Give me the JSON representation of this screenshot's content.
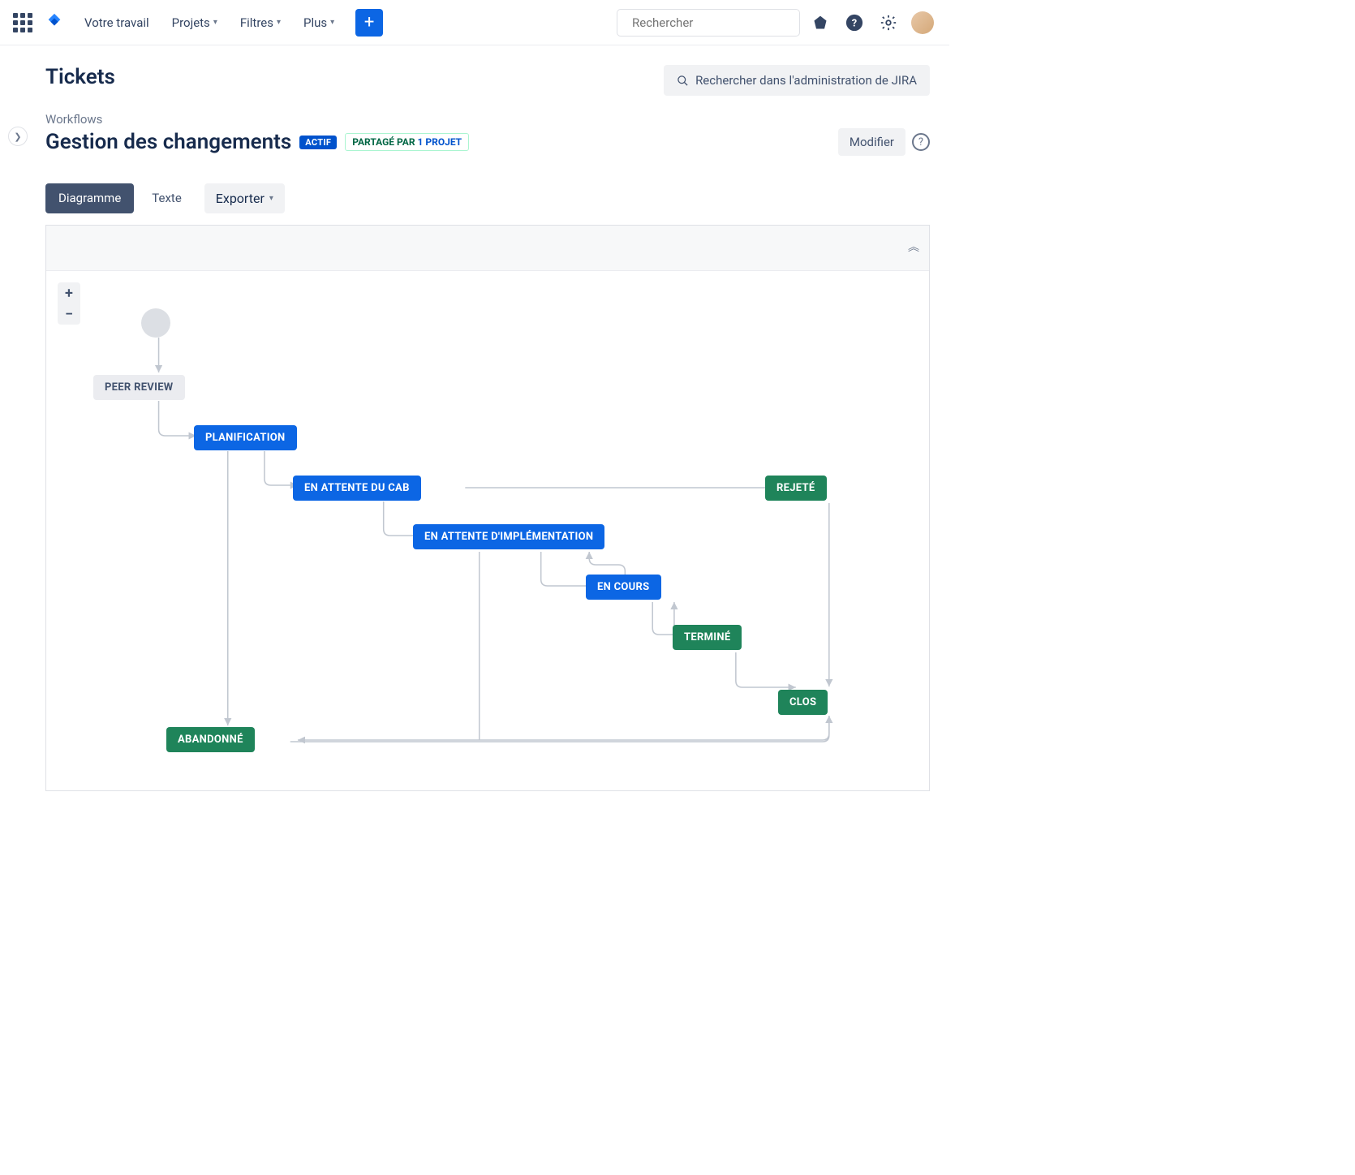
{
  "nav": {
    "items": [
      "Votre travail",
      "Projets",
      "Filtres",
      "Plus"
    ],
    "search_placeholder": "Rechercher"
  },
  "page": {
    "title": "Tickets",
    "admin_search": "Rechercher dans l'administration de JIRA",
    "breadcrumb": "Workflows",
    "workflow_title": "Gestion des changements",
    "badge_active": "ACTIF",
    "badge_shared_prefix": "PARTAGÉ PAR ",
    "badge_shared_link": "1 PROJET",
    "edit_button": "Modifier"
  },
  "tabs": {
    "diagram": "Diagramme",
    "text": "Texte",
    "export": "Exporter"
  },
  "zoom": {
    "in": "+",
    "out": "−"
  },
  "nodes": {
    "peer_review": "PEER REVIEW",
    "planification": "PLANIFICATION",
    "cab": "EN ATTENTE DU CAB",
    "impl": "EN ATTENTE D'IMPLÉMENTATION",
    "en_cours": "EN COURS",
    "termine": "TERMINÉ",
    "clos": "CLOS",
    "rejete": "REJETÉ",
    "abandonne": "ABANDONNÉ"
  }
}
